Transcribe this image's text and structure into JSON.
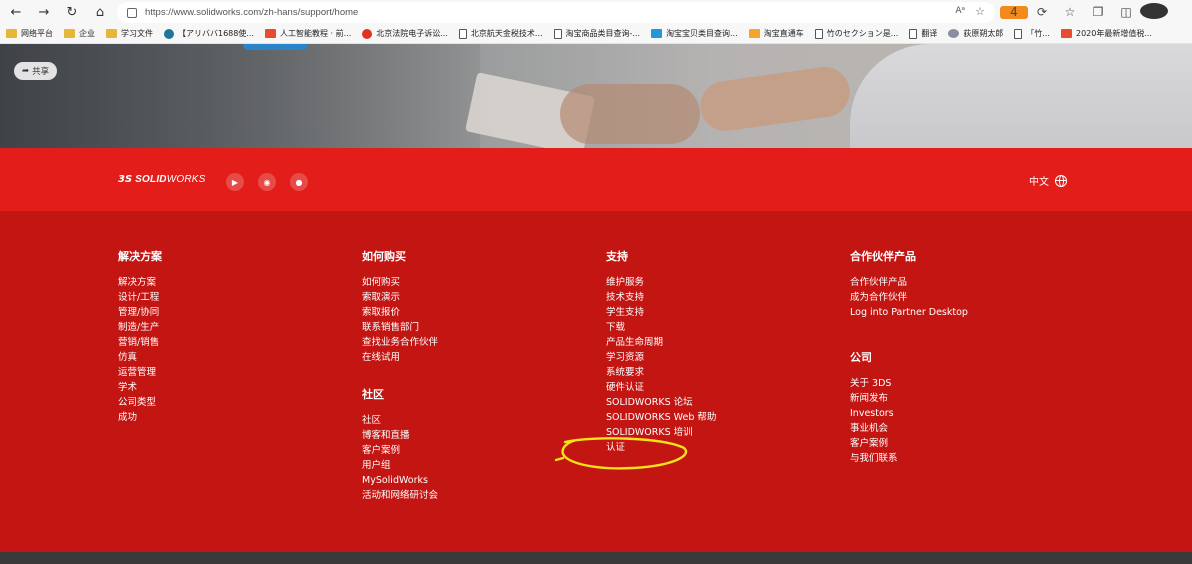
{
  "browser": {
    "url": "https://www.solidworks.com/zh-hans/support/home",
    "read_aloud_label": "Aᵃ",
    "bookmarks": [
      {
        "label": "网络平台",
        "icon": "folder"
      },
      {
        "label": "企业",
        "icon": "folder"
      },
      {
        "label": "学习文件",
        "icon": "folder"
      },
      {
        "label": "【アリババ1688使...",
        "icon": "wp"
      },
      {
        "label": "人工智能教程 · 前...",
        "icon": "red"
      },
      {
        "label": "北京法院电子诉讼...",
        "icon": "redround"
      },
      {
        "label": "北京航天金税技术...",
        "icon": "doc"
      },
      {
        "label": "淘宝商品类目查询-...",
        "icon": "doc"
      },
      {
        "label": "淘宝宝贝类目查询...",
        "icon": "teal"
      },
      {
        "label": "淘宝直通车",
        "icon": "orange"
      },
      {
        "label": "竹のセクション是...",
        "icon": "doc"
      },
      {
        "label": "翻译",
        "icon": "doc"
      },
      {
        "label": "荻原朔太郎",
        "icon": "gray"
      },
      {
        "label": "「竹...",
        "icon": "doc"
      },
      {
        "label": "2020年最新增值税...",
        "icon": "red"
      }
    ]
  },
  "hero": {
    "share_label": "共享"
  },
  "header": {
    "logo_ds": "3S",
    "logo_bold": "SOLID",
    "logo_rest": "WORKS",
    "language": "中文",
    "social_icons": [
      "youku-icon",
      "weibo-icon",
      "wechat-icon"
    ]
  },
  "footer": {
    "solutions": {
      "title": "解决方案",
      "items": [
        "解决方案",
        "设计/工程",
        "管理/协同",
        "制造/生产",
        "营销/销售",
        "仿真",
        "运营管理",
        "学术",
        "公司类型",
        "成功"
      ]
    },
    "buy": {
      "title": "如何购买",
      "items": [
        "如何购买",
        "索取演示",
        "索取报价",
        "联系销售部门",
        "查找业务合作伙伴",
        "在线试用"
      ]
    },
    "community": {
      "title": "社区",
      "items": [
        "社区",
        "博客和直播",
        "客户案例",
        "用户组",
        "MySolidWorks",
        "活动和网络研讨会"
      ]
    },
    "support": {
      "title": "支持",
      "items": [
        "维护服务",
        "技术支持",
        "学生支持",
        "下载",
        "产品生命周期",
        "学习资源",
        "系统要求",
        "硬件认证",
        "SOLIDWORKS 论坛",
        "SOLIDWORKS Web 帮助",
        "SOLIDWORKS 培训",
        "认证"
      ]
    },
    "partners": {
      "title": "合作伙伴产品",
      "items": [
        "合作伙伴产品",
        "成为合作伙伴",
        "Log into Partner Desktop"
      ]
    },
    "company": {
      "title": "公司",
      "items": [
        "关于 3DS",
        "新闻发布",
        "Investors",
        "事业机会",
        "客户案例",
        "与我们联系"
      ]
    }
  },
  "colors": {
    "brand_red": "#e31d1a",
    "footer_red": "#c31613",
    "highlight_yellow": "#f4e21a"
  }
}
